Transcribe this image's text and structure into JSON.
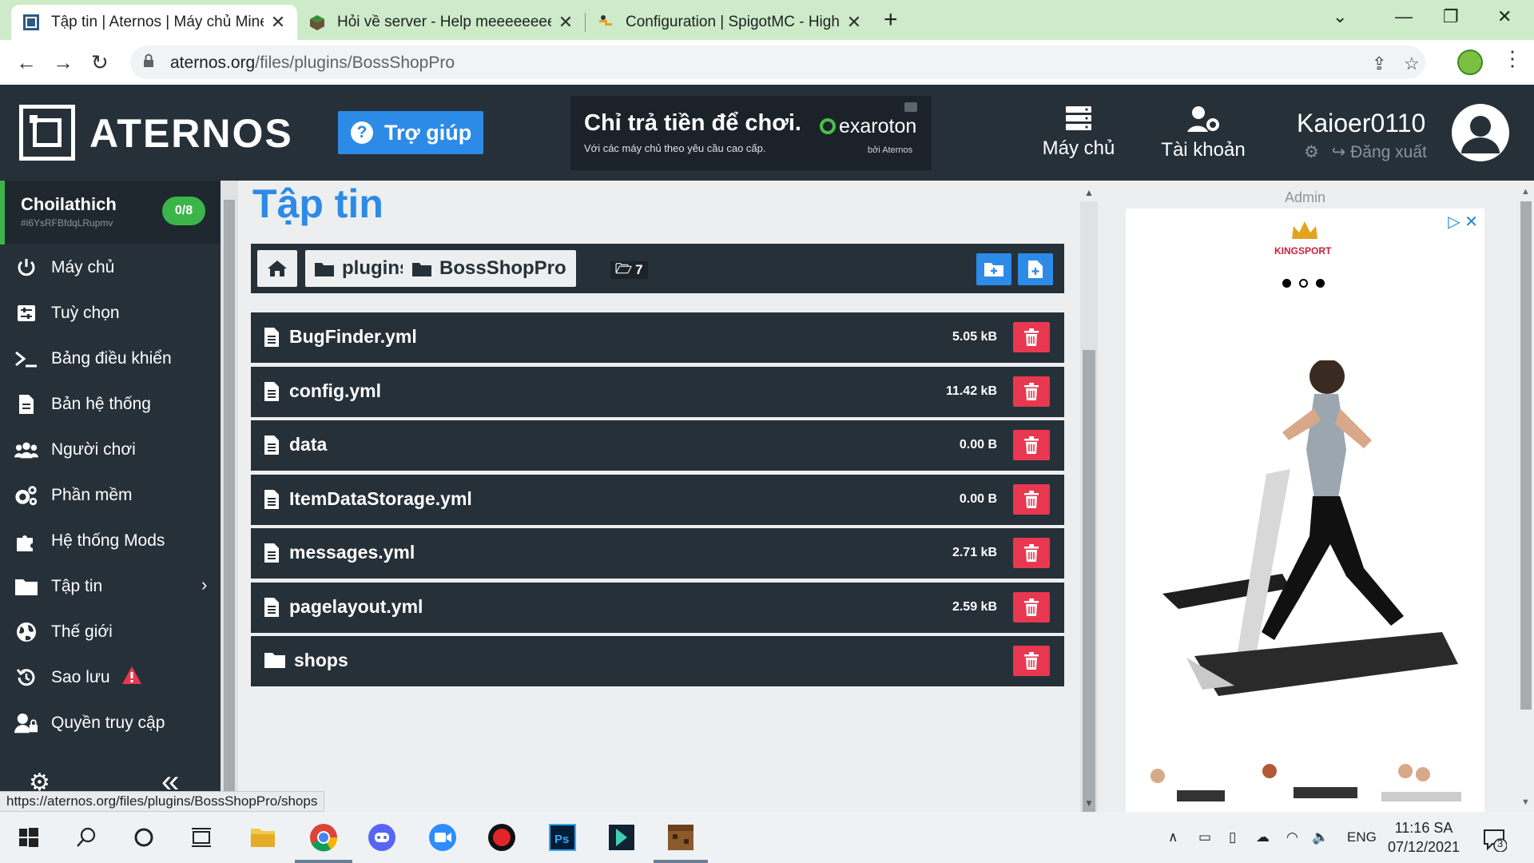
{
  "browser": {
    "tabs": [
      {
        "title": "Tập tin | Aternos | Máy chủ Mine",
        "active": true
      },
      {
        "title": "Hỏi về server - Help meeeeeeee",
        "active": false
      },
      {
        "title": "Configuration | SpigotMC - High",
        "active": false
      }
    ],
    "url_host": "aternos.org",
    "url_path": "/files/plugins/BossShopPro"
  },
  "header": {
    "logo_text": "ATERNOS",
    "help_label": "Trợ giúp",
    "ad_line1": "Chỉ trả tiền để chơi.",
    "ad_line2": "Với các máy chủ theo yêu cầu cao cấp.",
    "ad_brand": "exaroton",
    "ad_by": "bởi Aternos",
    "nav_server": "Máy chủ",
    "nav_account": "Tài khoản",
    "username": "Kaioer0110",
    "logout": "Đăng xuất"
  },
  "sidebar": {
    "server_name": "Choilathich",
    "server_id": "#i6YsRFBfdqLRupmv",
    "player_count": "0/8",
    "items": [
      {
        "label": "Máy chủ",
        "icon": "power-icon"
      },
      {
        "label": "Tuỳ chọn",
        "icon": "options-icon"
      },
      {
        "label": "Bảng điều khiển",
        "icon": "console-icon"
      },
      {
        "label": "Bản hệ thống",
        "icon": "log-icon"
      },
      {
        "label": "Người chơi",
        "icon": "players-icon"
      },
      {
        "label": "Phần mềm",
        "icon": "software-icon"
      },
      {
        "label": "Hệ thống Mods",
        "icon": "mods-icon"
      },
      {
        "label": "Tập tin",
        "icon": "folder-icon"
      },
      {
        "label": "Thế giới",
        "icon": "globe-icon"
      },
      {
        "label": "Sao lưu",
        "icon": "backup-icon"
      },
      {
        "label": "Quyền truy cập",
        "icon": "access-icon"
      }
    ]
  },
  "main": {
    "title": "Tập tin",
    "crumbs": [
      "plugins",
      "BossShopPro"
    ],
    "folder_count": "7",
    "files": [
      {
        "name": "BugFinder.yml",
        "size": "5.05 kB",
        "type": "file"
      },
      {
        "name": "config.yml",
        "size": "11.42 kB",
        "type": "file"
      },
      {
        "name": "data",
        "size": "0.00 B",
        "type": "file"
      },
      {
        "name": "ItemDataStorage.yml",
        "size": "0.00 B",
        "type": "file"
      },
      {
        "name": "messages.yml",
        "size": "2.71 kB",
        "type": "file"
      },
      {
        "name": "pagelayout.yml",
        "size": "2.59 kB",
        "type": "file"
      },
      {
        "name": "shops",
        "size": "",
        "type": "folder"
      }
    ]
  },
  "right_ad": {
    "admin_label": "Admin",
    "brand": "KINGSPORT"
  },
  "status_url": "https://aternos.org/files/plugins/BossShopPro/shops",
  "taskbar": {
    "language": "ENG",
    "time": "11:16 SA",
    "date": "07/12/2021",
    "notifications": "3"
  },
  "colors": {
    "accent_blue": "#2c8be6",
    "dark": "#263039",
    "green": "#3bb54a",
    "delete_red": "#e8384f"
  }
}
